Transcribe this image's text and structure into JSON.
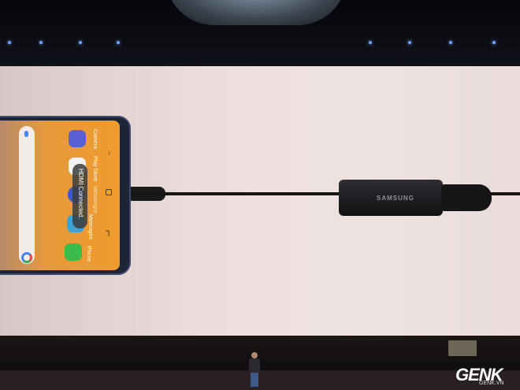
{
  "phone": {
    "apps": [
      {
        "label": "Camera",
        "color": "#5b5fd6"
      },
      {
        "label": "Play Store",
        "color": "#f2f2f2"
      },
      {
        "label": "Messenger",
        "color": "#3b55d8"
      },
      {
        "label": "Messages",
        "color": "#3aa3d8"
      },
      {
        "label": "Phone",
        "color": "#3dbb4a"
      }
    ],
    "toast": "HDMI Connected."
  },
  "adapter": {
    "brand": "SAMSUNG"
  },
  "watermark": {
    "logo": "GENK",
    "site": "GENK.VN"
  }
}
